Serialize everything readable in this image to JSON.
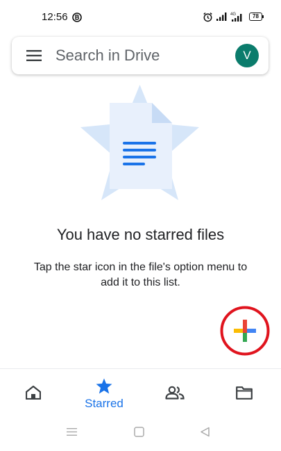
{
  "status_bar": {
    "time": "12:56",
    "battery": "78"
  },
  "search": {
    "placeholder": "Search in Drive",
    "avatar_initial": "V"
  },
  "empty_state": {
    "title": "You have no starred files",
    "description": "Tap the star icon in the file's option menu to add it to this list."
  },
  "bottom_nav": {
    "active_label": "Starred",
    "items": [
      "home-icon",
      "star-icon",
      "people-icon",
      "folder-icon"
    ]
  },
  "colors": {
    "accent": "#1a73e8",
    "avatar": "#0b7c6c",
    "highlight_ring": "#e0141e",
    "illustration_star": "#d6e6f9",
    "document_lines": "#1a73e8",
    "plus_red": "#ea4335",
    "plus_blue": "#4285f4",
    "plus_green": "#34a853",
    "plus_yellow": "#fbbc04"
  }
}
